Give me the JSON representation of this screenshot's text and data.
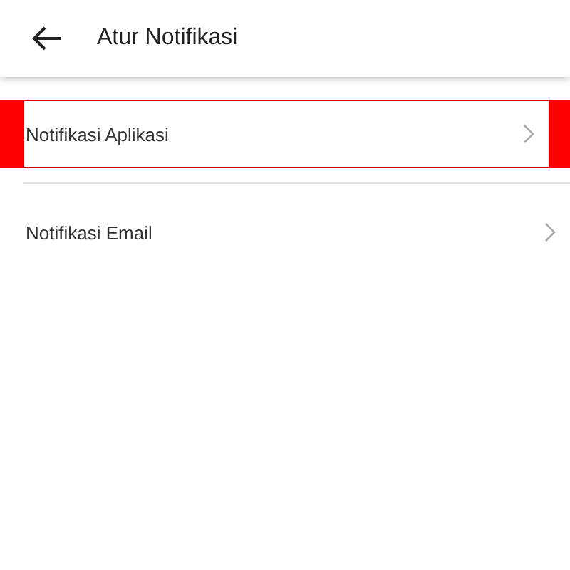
{
  "app_bar": {
    "title": "Atur Notifikasi"
  },
  "items": [
    {
      "label": "Notifikasi Aplikasi",
      "highlighted": true
    },
    {
      "label": "Notifikasi Email",
      "highlighted": false
    }
  ]
}
